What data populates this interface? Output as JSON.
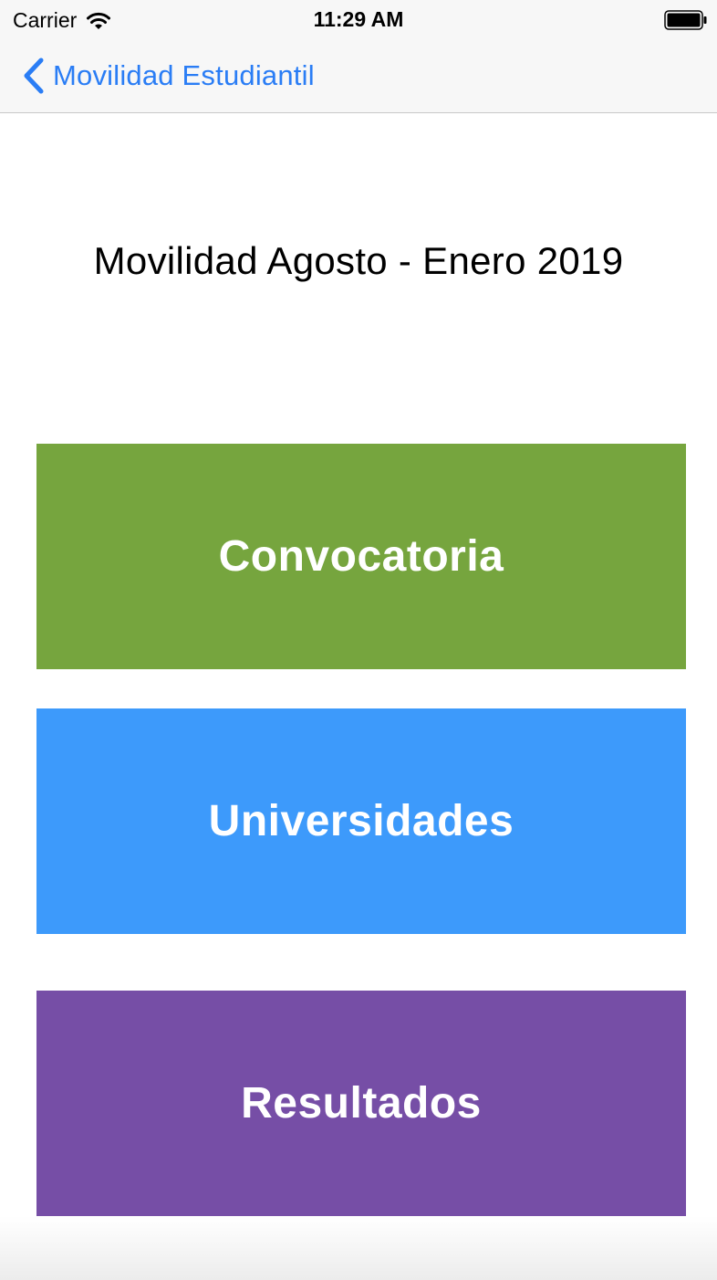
{
  "status_bar": {
    "carrier": "Carrier",
    "time": "11:29 AM",
    "icons": [
      "wifi-icon",
      "battery-icon"
    ]
  },
  "nav": {
    "back_label": "Movilidad Estudiantil",
    "back_icon": "chevron-left-icon",
    "accent_color": "#2a7df5"
  },
  "main": {
    "title": "Movilidad Agosto - Enero 2019",
    "buttons": [
      {
        "label": "Convocatoria",
        "color": "#76a53e"
      },
      {
        "label": "Universidades",
        "color": "#3d9afb"
      },
      {
        "label": "Resultados",
        "color": "#764ea6"
      }
    ]
  }
}
